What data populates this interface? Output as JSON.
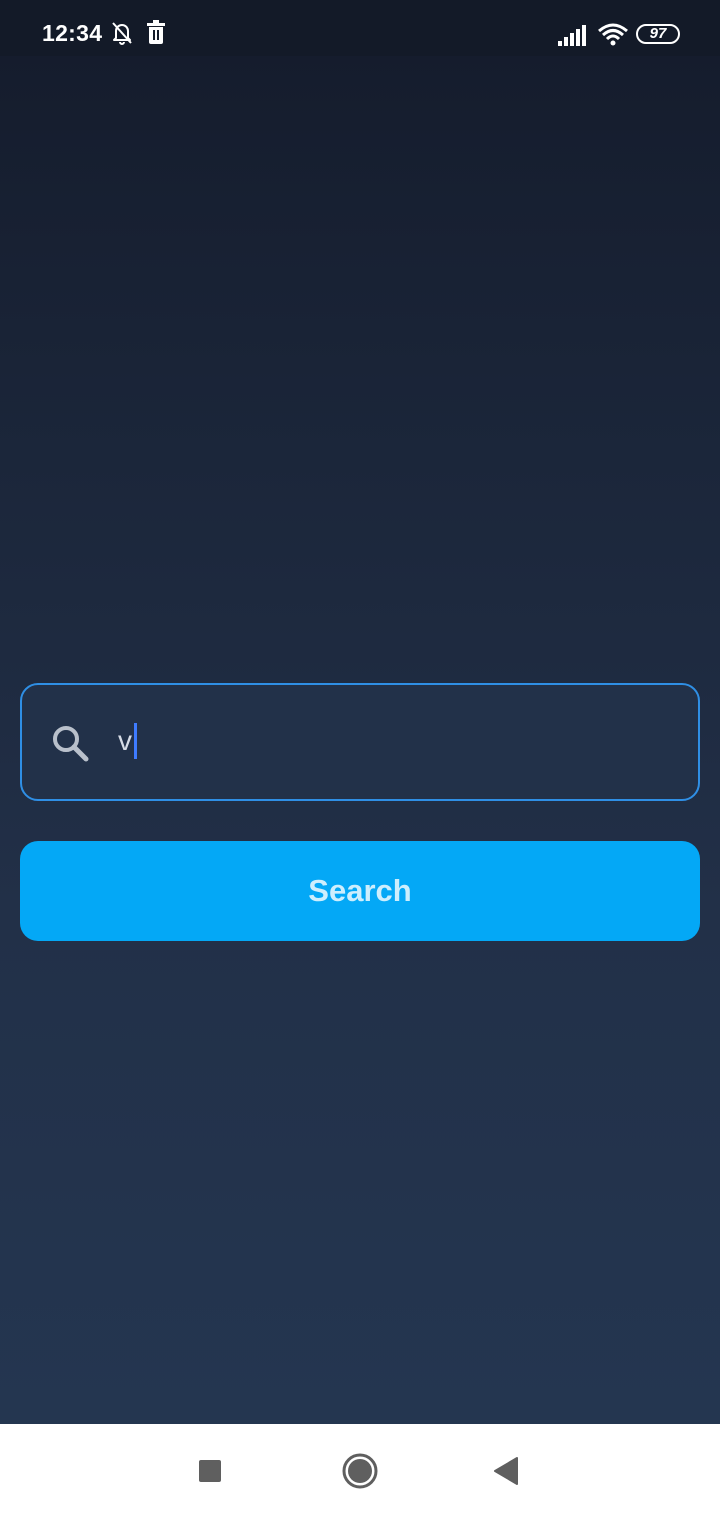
{
  "status_bar": {
    "time": "12:34",
    "battery": "97",
    "icons": [
      "bell-off-icon",
      "trash-icon",
      "signal-icon",
      "wifi-icon",
      "battery-icon"
    ]
  },
  "search": {
    "value": "v",
    "icon": "search-icon",
    "border_color": "#2f8fe5"
  },
  "button": {
    "label": "Search",
    "color": "#04a8f6"
  },
  "nav_bar": {
    "icons": [
      "recents-icon",
      "home-icon",
      "back-icon"
    ]
  }
}
